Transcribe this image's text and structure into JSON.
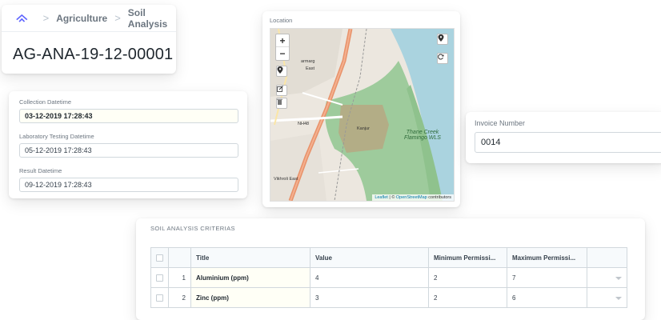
{
  "breadcrumb": {
    "items": [
      "Agriculture",
      "Soil Analysis"
    ],
    "separator": ">"
  },
  "doc": {
    "title": "AG-ANA-19-12-00001"
  },
  "dates": {
    "collection": {
      "label": "Collection Datetime",
      "value": "03-12-2019 17:28:43"
    },
    "lab_testing": {
      "label": "Laboratory Testing Datetime",
      "value": "05-12-2019 17:28:43"
    },
    "result": {
      "label": "Result Datetime",
      "value": "09-12-2019 17:28:43"
    }
  },
  "map": {
    "label": "Location",
    "zoom_in": "+",
    "zoom_out": "−",
    "place_labels": {
      "marg": "armarg",
      "east": "East",
      "road": "NH48",
      "kanjur": "Kanjur",
      "vikhroli": "Vikhroli East",
      "flamingo": "Thane Creek Flamingo WLS"
    },
    "attribution": {
      "leaflet": "Leaflet",
      "sep": " | © ",
      "osm": "OpenStreetMap",
      "suffix": " contributors"
    },
    "colors": {
      "park": "#b7cfa5",
      "wetland": "#9ecb9c",
      "water": "#aad3df",
      "road": "#e8926a",
      "land": "#ece7df"
    }
  },
  "invoice": {
    "label": "Invoice Number",
    "value": "0014"
  },
  "criteria": {
    "heading": "SOIL ANALYSIS CRITERIAS",
    "columns": [
      "Title",
      "Value",
      "Minimum Permissi...",
      "Maximum Permissi..."
    ],
    "rows": [
      {
        "idx": "1",
        "title": "Aluminium (ppm)",
        "value": "4",
        "min": "2",
        "max": "7"
      },
      {
        "idx": "2",
        "title": "Zinc (ppm)",
        "value": "3",
        "min": "2",
        "max": "6"
      }
    ]
  },
  "icons": {
    "logo": "erpnext-logo-icon",
    "marker": "map-marker-icon",
    "edit": "edit-icon",
    "trash": "trash-icon",
    "refresh": "refresh-icon",
    "caret": "caret-down-icon"
  }
}
